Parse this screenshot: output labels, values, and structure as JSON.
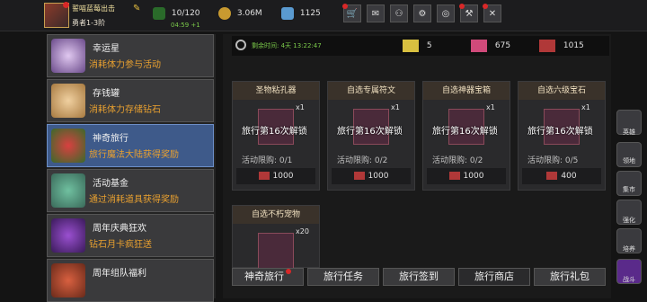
{
  "player": {
    "name": "誓喵蓝莓出击",
    "rank": "勇者1-3阶"
  },
  "resources": {
    "stamina": "10/120",
    "stamina_timer": "04:59 +1",
    "gold": "3.06M",
    "gems": "1125"
  },
  "top_icons": [
    "cart-icon",
    "mail-icon",
    "gamepad-icon",
    "settings-icon",
    "event-icon",
    "hammer-icon",
    "exit-icon"
  ],
  "event_list": [
    {
      "title": "幸运星",
      "subtitle": "消耗体力参与活动",
      "icon": "star-icon"
    },
    {
      "title": "存钱罐",
      "subtitle": "消耗体力存储钻石",
      "icon": "piggybank-icon"
    },
    {
      "title": "神奇旅行",
      "subtitle": "旅行魔法大陆获得奖励",
      "icon": "gift-icon"
    },
    {
      "title": "活动基金",
      "subtitle": "通过消耗道具获得奖励",
      "icon": "moneybag-icon"
    },
    {
      "title": "周年庆典狂欢",
      "subtitle": "钻石月卡疯狂送",
      "icon": "treasure-icon"
    },
    {
      "title": "周年组队福利",
      "subtitle": "",
      "icon": "chest-icon"
    }
  ],
  "info": {
    "remaining_time": "剩余时间: 4天 13:22:47",
    "tickets": "5",
    "candy": "675",
    "shoes": "1015"
  },
  "shop_items": [
    {
      "title": "圣物粘孔器",
      "count": "x1",
      "lock": "旅行第16次解锁",
      "limit": "活动限购: 0/1",
      "price": "1000"
    },
    {
      "title": "自选专属符文",
      "count": "x1",
      "lock": "旅行第16次解锁",
      "limit": "活动限购: 0/2",
      "price": "1000"
    },
    {
      "title": "自选神器宝箱",
      "count": "x1",
      "lock": "旅行第16次解锁",
      "limit": "活动限购: 0/2",
      "price": "1000"
    },
    {
      "title": "自选六级宝石",
      "count": "x1",
      "lock": "旅行第16次解锁",
      "limit": "活动限购: 0/5",
      "price": "400"
    },
    {
      "title": "自选不朽宠物",
      "count": "x20",
      "lock": "",
      "limit": "",
      "price": ""
    }
  ],
  "tabs": [
    {
      "label": "神奇旅行",
      "dot": true
    },
    {
      "label": "旅行任务",
      "dot": false
    },
    {
      "label": "旅行签到",
      "dot": false
    },
    {
      "label": "旅行商店",
      "dot": false
    },
    {
      "label": "旅行礼包",
      "dot": false
    }
  ],
  "side_menu": [
    "英雄",
    "领地",
    "集市",
    "强化",
    "培养",
    "战斗"
  ]
}
